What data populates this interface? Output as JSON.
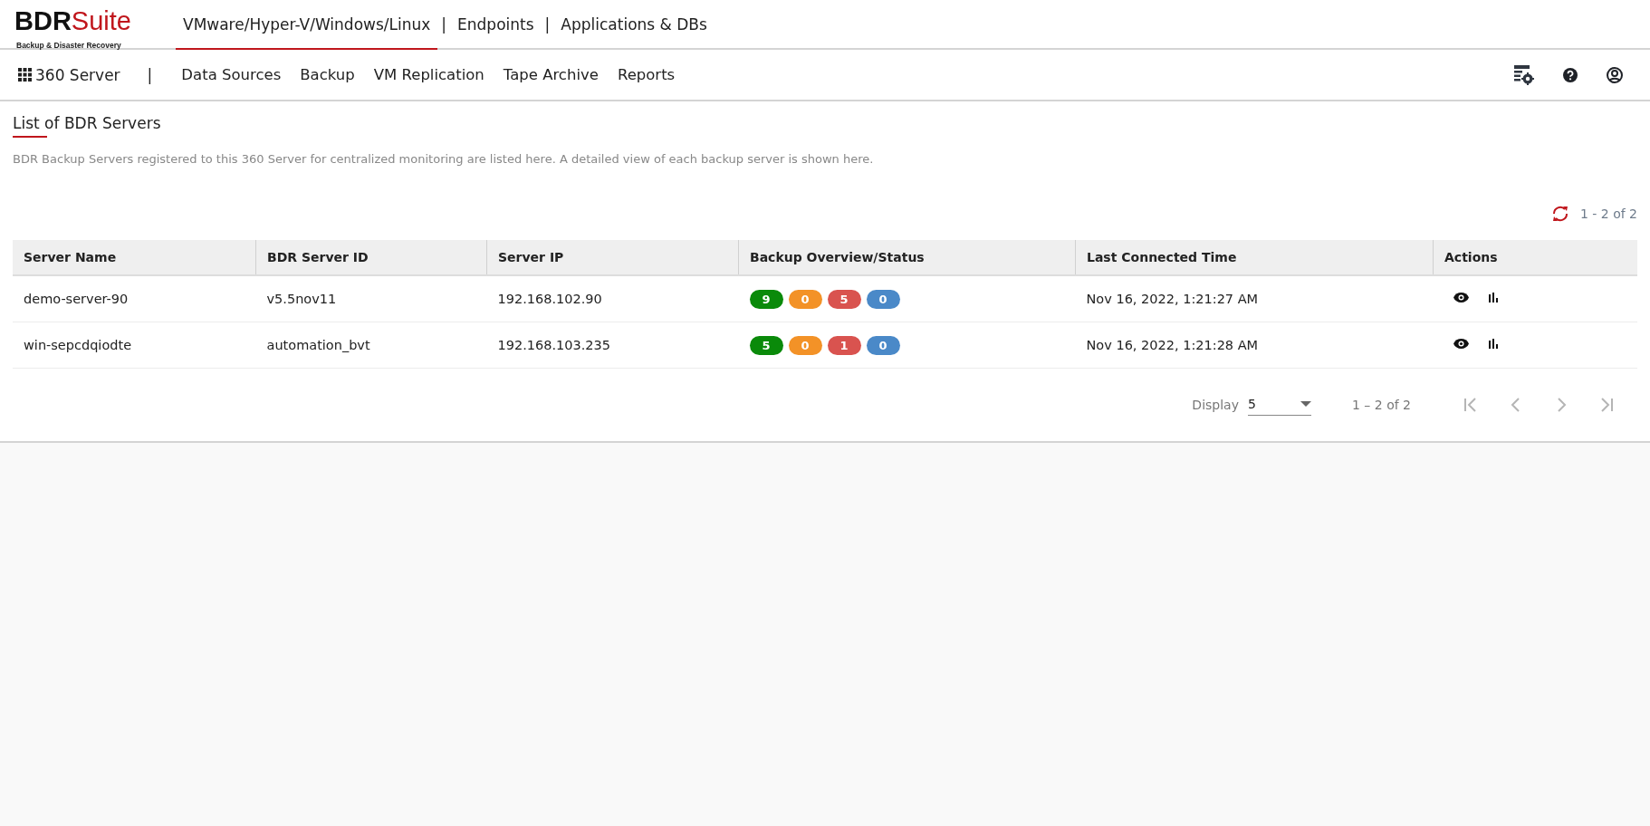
{
  "logo": {
    "brand_dark": "BDR",
    "brand_red": "Suite",
    "tagline": "Backup & Disaster Recovery"
  },
  "product_tabs": [
    {
      "label": "VMware/Hyper-V/Windows/Linux",
      "selected": true
    },
    {
      "label": "Endpoints",
      "selected": false
    },
    {
      "label": "Applications & DBs",
      "selected": false
    }
  ],
  "tab_separator": "|",
  "nav": {
    "app_label": "360 Server",
    "separator": "|",
    "items": [
      "Data Sources",
      "Backup",
      "VM Replication",
      "Tape Archive",
      "Reports"
    ]
  },
  "page": {
    "title": "List of BDR Servers",
    "description": "BDR Backup Servers registered to this 360 Server for centralized monitoring are listed here. A detailed view of each backup server is shown here.",
    "range": "1 - 2 of 2"
  },
  "table": {
    "columns": [
      "Server Name",
      "BDR Server ID",
      "Server IP",
      "Backup Overview/Status",
      "Last Connected Time",
      "Actions"
    ],
    "rows": [
      {
        "name": "demo-server-90",
        "id": "v5.5nov11",
        "ip": "192.168.102.90",
        "status": [
          {
            "count": "9",
            "color": "#0a8a0a"
          },
          {
            "count": "0",
            "color": "#f39227"
          },
          {
            "count": "5",
            "color": "#d9534f"
          },
          {
            "count": "0",
            "color": "#4a89c8"
          }
        ],
        "time": "Nov 16, 2022, 1:21:27 AM"
      },
      {
        "name": "win-sepcdqiodte",
        "id": "automation_bvt",
        "ip": "192.168.103.235",
        "status": [
          {
            "count": "5",
            "color": "#0a8a0a"
          },
          {
            "count": "0",
            "color": "#f39227"
          },
          {
            "count": "1",
            "color": "#d9534f"
          },
          {
            "count": "0",
            "color": "#4a89c8"
          }
        ],
        "time": "Nov 16, 2022, 1:21:28 AM"
      }
    ]
  },
  "pagination": {
    "display_label": "Display",
    "page_size": "5",
    "range": "1 – 2 of 2",
    "buttons": [
      {
        "kind": "first",
        "disabled": true
      },
      {
        "kind": "prev",
        "disabled": true
      },
      {
        "kind": "next",
        "disabled": true
      },
      {
        "kind": "last",
        "disabled": true
      }
    ]
  }
}
